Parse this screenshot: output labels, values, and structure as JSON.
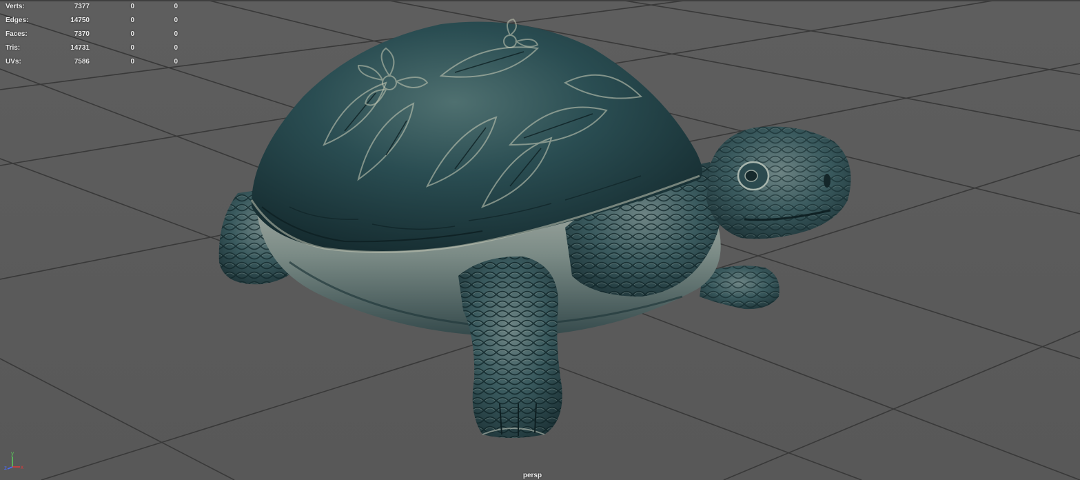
{
  "hud": {
    "rows": [
      {
        "label": "Verts:",
        "v1": "7377",
        "v2": "0",
        "v3": "0"
      },
      {
        "label": "Edges:",
        "v1": "14750",
        "v2": "0",
        "v3": "0"
      },
      {
        "label": "Faces:",
        "v1": "7370",
        "v2": "0",
        "v3": "0"
      },
      {
        "label": "Tris:",
        "v1": "14731",
        "v2": "0",
        "v3": "0"
      },
      {
        "label": "UVs:",
        "v1": "7586",
        "v2": "0",
        "v3": "0"
      }
    ]
  },
  "viewport": {
    "camera": "persp",
    "background_color": "#5b5b5b",
    "grid_color": "#3a3a3a"
  },
  "axis_gizmo": {
    "labels": {
      "x": "x",
      "y": "y",
      "z": "z"
    },
    "colors": {
      "x": "#e23a3a",
      "y": "#5bd15b",
      "z": "#4a6cff"
    }
  },
  "model": {
    "name": "turtle-statue",
    "colors": {
      "shell": "#21494f",
      "skin": "#2f5358",
      "highlight": "#b9c2b6",
      "shadow": "#16272a"
    }
  }
}
